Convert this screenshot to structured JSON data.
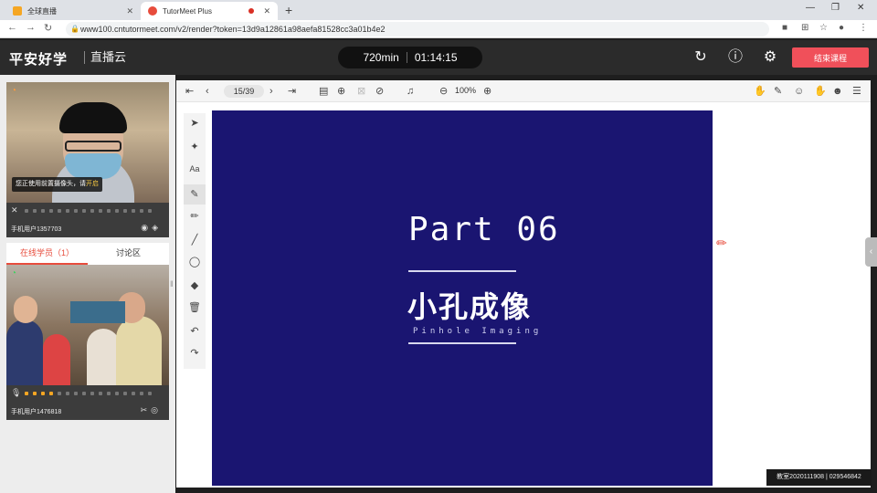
{
  "browser": {
    "tabs": [
      {
        "title": "全球直播",
        "active": false
      },
      {
        "title": "TutorMeet Plus",
        "active": true
      }
    ],
    "new_tab": "+",
    "url": "www100.cntutormeet.com/v2/render?token=13d9a12861a98aefa81528cc3a01b4e2"
  },
  "header": {
    "brand": "平安好学",
    "brand_sub": "直播云",
    "duration": "720min",
    "elapsed": "01:14:15",
    "end_button": "结束课程"
  },
  "left_panel": {
    "notice_text": "您正使用前置摄像头，请",
    "notice_link": "开启",
    "user1": "手机用户1357703",
    "tabs": [
      "在线学员（1）",
      "讨论区"
    ],
    "user2": "手机用户1476818",
    "user1_level": 0,
    "user2_level": 4
  },
  "toolbar": {
    "page": "15/39",
    "zoom": "100%"
  },
  "slide": {
    "part": "Part 06",
    "title": "小孔成像",
    "subtitle": "Pinhole Imaging"
  },
  "watermark": "教室2020111908 | 029546842",
  "colors": {
    "slide_bg": "#1a1571",
    "accent": "#f0505a"
  }
}
